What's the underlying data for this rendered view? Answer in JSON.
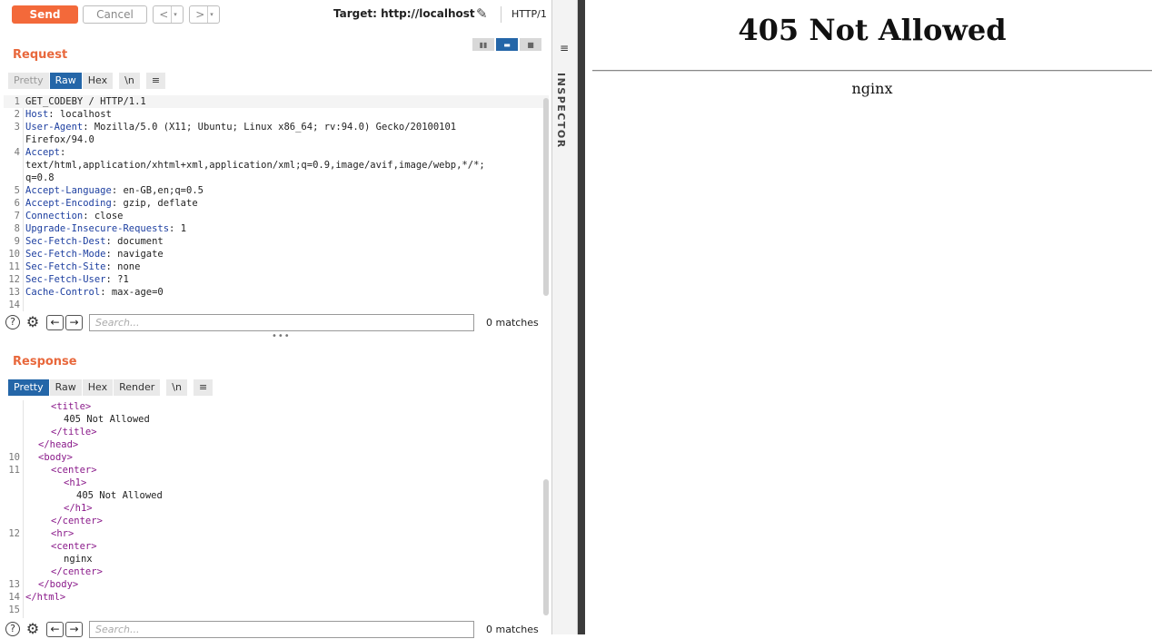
{
  "toolbar": {
    "send_label": "Send",
    "cancel_label": "Cancel",
    "back_label": "<",
    "forward_label": ">",
    "caret": "▾",
    "target_label": "Target: http://localhost",
    "protocol_label": "HTTP/1",
    "help_label": "?"
  },
  "request": {
    "title": "Request",
    "tabs": [
      {
        "label": "Pretty"
      },
      {
        "label": "Raw"
      },
      {
        "label": "Hex"
      },
      {
        "label": "\\n"
      },
      {
        "label": "≡"
      }
    ],
    "active_tab": "Raw",
    "lines": [
      {
        "n": "1",
        "name": "",
        "rest": "GET_CODEBY / HTTP/1.1"
      },
      {
        "n": "2",
        "name": "Host",
        "rest": ": localhost"
      },
      {
        "n": "3",
        "name": "User-Agent",
        "rest": ": Mozilla/5.0 (X11; Ubuntu; Linux x86_64; rv:94.0) Gecko/20100101"
      },
      {
        "n": "",
        "name": "",
        "rest": "Firefox/94.0"
      },
      {
        "n": "4",
        "name": "Accept",
        "rest": ":"
      },
      {
        "n": "",
        "name": "",
        "rest": "text/html,application/xhtml+xml,application/xml;q=0.9,image/avif,image/webp,*/*;"
      },
      {
        "n": "",
        "name": "",
        "rest": "q=0.8"
      },
      {
        "n": "5",
        "name": "Accept-Language",
        "rest": ": en-GB,en;q=0.5"
      },
      {
        "n": "6",
        "name": "Accept-Encoding",
        "rest": ": gzip, deflate"
      },
      {
        "n": "7",
        "name": "Connection",
        "rest": ": close"
      },
      {
        "n": "8",
        "name": "Upgrade-Insecure-Requests",
        "rest": ": 1"
      },
      {
        "n": "9",
        "name": "Sec-Fetch-Dest",
        "rest": ": document"
      },
      {
        "n": "10",
        "name": "Sec-Fetch-Mode",
        "rest": ": navigate"
      },
      {
        "n": "11",
        "name": "Sec-Fetch-Site",
        "rest": ": none"
      },
      {
        "n": "12",
        "name": "Sec-Fetch-User",
        "rest": ": ?1"
      },
      {
        "n": "13",
        "name": "Cache-Control",
        "rest": ": max-age=0"
      },
      {
        "n": "14",
        "name": "",
        "rest": ""
      }
    ],
    "search_placeholder": "Search...",
    "matches": "0 matches"
  },
  "response": {
    "title": "Response",
    "tabs": [
      {
        "label": "Pretty"
      },
      {
        "label": "Raw"
      },
      {
        "label": "Hex"
      },
      {
        "label": "Render"
      },
      {
        "label": "\\n"
      },
      {
        "label": "≡"
      }
    ],
    "active_tab": "Pretty",
    "lines": [
      {
        "n": "",
        "indent": 2,
        "tag": "<title>",
        "text": ""
      },
      {
        "n": "",
        "indent": 3,
        "tag": "",
        "text": "405 Not Allowed"
      },
      {
        "n": "",
        "indent": 2,
        "tag": "</title>",
        "text": ""
      },
      {
        "n": "",
        "indent": 1,
        "tag": "</head>",
        "text": ""
      },
      {
        "n": "10",
        "indent": 1,
        "tag": "<body>",
        "text": ""
      },
      {
        "n": "11",
        "indent": 2,
        "tag": "<center>",
        "text": ""
      },
      {
        "n": "",
        "indent": 3,
        "tag": "<h1>",
        "text": ""
      },
      {
        "n": "",
        "indent": 4,
        "tag": "",
        "text": "405 Not Allowed"
      },
      {
        "n": "",
        "indent": 3,
        "tag": "</h1>",
        "text": ""
      },
      {
        "n": "",
        "indent": 2,
        "tag": "</center>",
        "text": ""
      },
      {
        "n": "12",
        "indent": 2,
        "tag": "<hr>",
        "text": ""
      },
      {
        "n": "",
        "indent": 2,
        "tag": "<center>",
        "text": ""
      },
      {
        "n": "",
        "indent": 3,
        "tag": "",
        "text": "nginx"
      },
      {
        "n": "",
        "indent": 2,
        "tag": "</center>",
        "text": ""
      },
      {
        "n": "13",
        "indent": 1,
        "tag": "</body>",
        "text": ""
      },
      {
        "n": "14",
        "indent": 0,
        "tag": "</html>",
        "text": ""
      },
      {
        "n": "15",
        "indent": 0,
        "tag": "",
        "text": ""
      }
    ],
    "search_placeholder": "Search...",
    "matches": "0 matches"
  },
  "inspector": {
    "label": "INSPECTOR",
    "icon": "panel-menu-icon"
  },
  "browser_page": {
    "heading": "405 Not Allowed",
    "footer": "nginx"
  },
  "colors": {
    "accent": "#f3693a",
    "section_title": "#e8683c",
    "active_tab": "#2466a8",
    "header_name": "#1d3fa0",
    "html_tag": "#8a1a8a",
    "divider": "#3b3b3b"
  }
}
